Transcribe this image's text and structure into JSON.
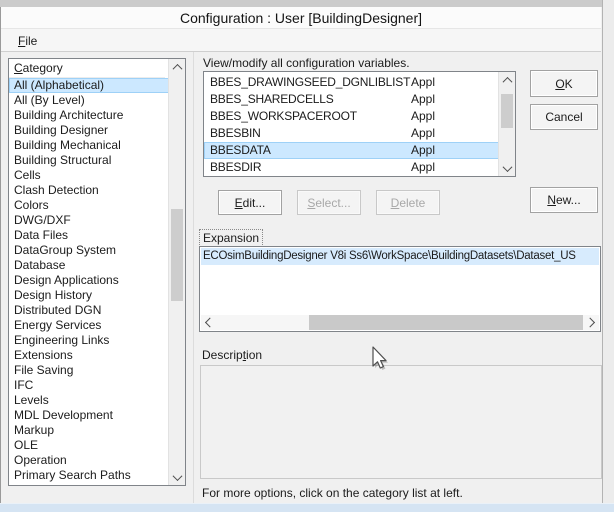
{
  "window": {
    "title": "Configuration : User [BuildingDesigner]",
    "menu": [
      {
        "label": "File"
      }
    ]
  },
  "category_panel": {
    "header": "Category",
    "selected_index": 0,
    "items": [
      "All (Alphabetical)",
      "All (By Level)",
      "Building Architecture",
      "Building Designer",
      "Building Mechanical",
      "Building Structural",
      "Cells",
      "Clash Detection",
      "Colors",
      "DWG/DXF",
      "Data Files",
      "DataGroup System",
      "Database",
      "Design Applications",
      "Design History",
      "Distributed DGN",
      "Energy Services",
      "Engineering Links",
      "Extensions",
      "File Saving",
      "IFC",
      "Levels",
      "MDL Development",
      "Markup",
      "OLE",
      "Operation",
      "Primary Search Paths"
    ]
  },
  "variables_panel": {
    "caption": "View/modify all configuration variables.",
    "selected_index": 4,
    "rows": [
      {
        "name": "BBES_DRAWINGSEED_DGNLIBLIST",
        "level": "Appl"
      },
      {
        "name": "BBES_SHAREDCELLS",
        "level": "Appl"
      },
      {
        "name": "BBES_WORKSPACEROOT",
        "level": "Appl"
      },
      {
        "name": "BBESBIN",
        "level": "Appl"
      },
      {
        "name": "BBESDATA",
        "level": "Appl"
      },
      {
        "name": "BBESDIR",
        "level": "Appl"
      }
    ]
  },
  "buttons": {
    "ok": "OK",
    "cancel": "Cancel",
    "new": "New...",
    "edit": "Edit...",
    "select": "Select...",
    "delete": "Delete"
  },
  "expansion": {
    "label": "Expansion",
    "value": "ECOsimBuildingDesigner V8i Ss6\\WorkSpace\\BuildingDatasets\\Dataset_US"
  },
  "description": {
    "label": "Description",
    "value": ""
  },
  "footer": {
    "hint": "For more options, click on the category list at left."
  },
  "colors": {
    "selection": "#cce8ff",
    "selection_border": "#9ed1f7",
    "body": "#f0f0f0"
  }
}
